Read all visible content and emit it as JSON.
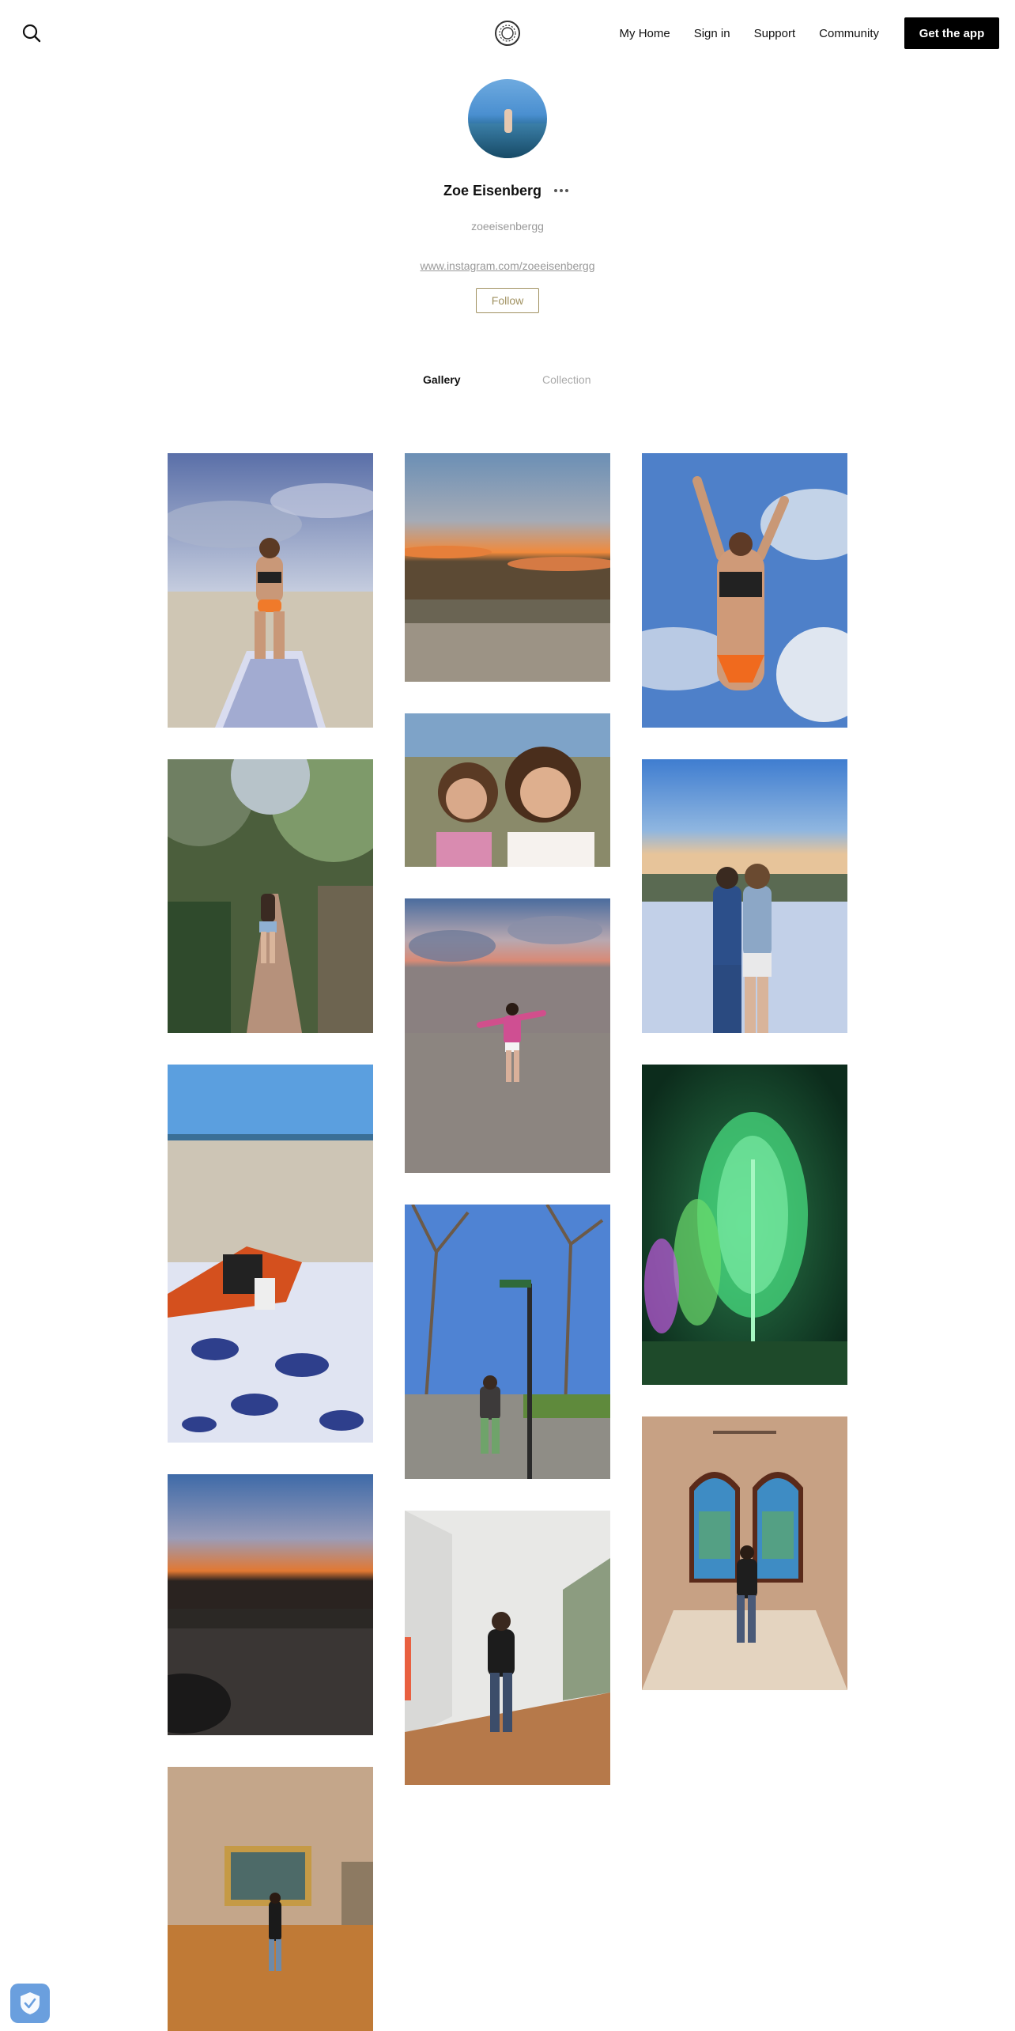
{
  "header": {
    "search_icon": "search-icon",
    "logo_icon": "ring-logo-icon",
    "nav": [
      "My Home",
      "Sign in",
      "Support",
      "Community"
    ],
    "cta": "Get the app"
  },
  "profile": {
    "name": "Zoe Eisenberg",
    "username": "zoeeisenbergg",
    "website": "www.instagram.com/zoeeisenbergg",
    "follow_label": "Follow"
  },
  "tabs": {
    "gallery": "Gallery",
    "collection": "Collection",
    "active": "Gallery"
  },
  "gallery": {
    "photos": [
      {
        "id": "beach-towel-pose",
        "column": 1
      },
      {
        "id": "path-in-jungle",
        "column": 1
      },
      {
        "id": "beach-towel-whales",
        "column": 1
      },
      {
        "id": "sunset-road",
        "column": 1
      },
      {
        "id": "museum-painting",
        "column": 1
      },
      {
        "id": "sunset-dunes",
        "column": 2
      },
      {
        "id": "two-friends-selfie",
        "column": 2
      },
      {
        "id": "beach-sunset-jump",
        "column": 2
      },
      {
        "id": "street-sign-trees",
        "column": 2
      },
      {
        "id": "gallery-wall",
        "column": 2
      },
      {
        "id": "arms-raised-sky",
        "column": 3
      },
      {
        "id": "friends-hugging-dunes",
        "column": 3
      },
      {
        "id": "green-light-trees",
        "column": 3
      },
      {
        "id": "stained-glass-windows",
        "column": 3
      }
    ]
  },
  "badges": {
    "privacy_shield_icon": "shield-check-icon"
  }
}
